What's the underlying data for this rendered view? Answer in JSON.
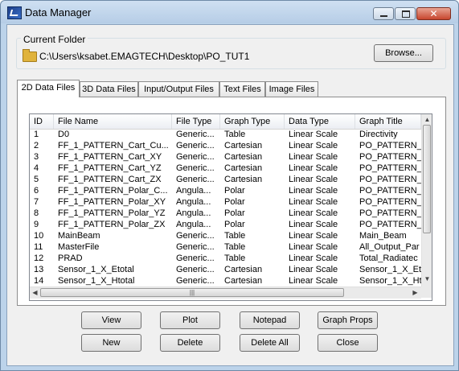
{
  "window": {
    "title": "Data Manager",
    "icon": "app-icon",
    "controls": [
      "minimize-icon",
      "maximize-icon",
      "close-icon"
    ],
    "close_glyph": "✕"
  },
  "current_folder": {
    "label": "Current Folder",
    "path": "C:\\Users\\ksabet.EMAGTECH\\Desktop\\PO_TUT1",
    "browse_label": "Browse..."
  },
  "tabs": [
    {
      "label": "2D Data Files",
      "active": true
    },
    {
      "label": "3D Data Files",
      "active": false
    },
    {
      "label": "Input/Output Files",
      "active": false
    },
    {
      "label": "Text Files",
      "active": false
    },
    {
      "label": "Image Files",
      "active": false
    }
  ],
  "table": {
    "columns": [
      "ID",
      "File Name",
      "File Type",
      "Graph Type",
      "Data Type",
      "Graph Title"
    ],
    "rows": [
      [
        "1",
        "D0",
        "Generic...",
        "Table",
        "Linear Scale",
        "Directivity"
      ],
      [
        "2",
        "FF_1_PATTERN_Cart_Cu...",
        "Generic...",
        "Cartesian",
        "Linear Scale",
        "PO_PATTERN_"
      ],
      [
        "3",
        "FF_1_PATTERN_Cart_XY",
        "Generic...",
        "Cartesian",
        "Linear Scale",
        "PO_PATTERN_"
      ],
      [
        "4",
        "FF_1_PATTERN_Cart_YZ",
        "Generic...",
        "Cartesian",
        "Linear Scale",
        "PO_PATTERN_"
      ],
      [
        "5",
        "FF_1_PATTERN_Cart_ZX",
        "Generic...",
        "Cartesian",
        "Linear Scale",
        "PO_PATTERN_"
      ],
      [
        "6",
        "FF_1_PATTERN_Polar_C...",
        "Angula...",
        "Polar",
        "Linear Scale",
        "PO_PATTERN_"
      ],
      [
        "7",
        "FF_1_PATTERN_Polar_XY",
        "Angula...",
        "Polar",
        "Linear Scale",
        "PO_PATTERN_"
      ],
      [
        "8",
        "FF_1_PATTERN_Polar_YZ",
        "Angula...",
        "Polar",
        "Linear Scale",
        "PO_PATTERN_"
      ],
      [
        "9",
        "FF_1_PATTERN_Polar_ZX",
        "Angula...",
        "Polar",
        "Linear Scale",
        "PO_PATTERN_"
      ],
      [
        "10",
        "MainBeam",
        "Generic...",
        "Table",
        "Linear Scale",
        "Main_Beam"
      ],
      [
        "11",
        "MasterFile",
        "Generic...",
        "Table",
        "Linear Scale",
        "All_Output_Par"
      ],
      [
        "12",
        "PRAD",
        "Generic...",
        "Table",
        "Linear Scale",
        "Total_Radiatec"
      ],
      [
        "13",
        "Sensor_1_X_Etotal",
        "Generic...",
        "Cartesian",
        "Linear Scale",
        "Sensor_1_X_Et"
      ],
      [
        "14",
        "Sensor_1_X_Htotal",
        "Generic...",
        "Cartesian",
        "Linear Scale",
        "Sensor_1_X_Ht"
      ]
    ],
    "scroll_up_glyph": "▲",
    "scroll_down_glyph": "▼",
    "scroll_left_glyph": "◀",
    "scroll_right_glyph": "▶",
    "hthumb_grip": "|||"
  },
  "buttons": {
    "view": "View",
    "plot": "Plot",
    "notepad": "Notepad",
    "graph_props": "Graph Props",
    "new": "New",
    "delete": "Delete",
    "delete_all": "Delete All",
    "close": "Close"
  }
}
